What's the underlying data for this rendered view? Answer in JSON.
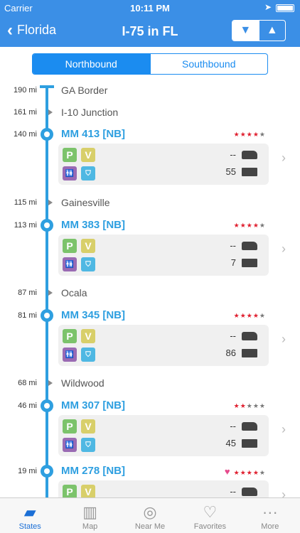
{
  "status": {
    "carrier": "Carrier",
    "time": "10:11 PM"
  },
  "nav": {
    "back_label": "Florida",
    "title": "I-75 in FL"
  },
  "segments": {
    "northbound": "Northbound",
    "southbound": "Southbound"
  },
  "route": {
    "landmarks": [
      {
        "mile": "190 mi",
        "name": "GA Border"
      },
      {
        "mile": "161 mi",
        "name": "I-10 Junction"
      },
      {
        "mile": "115 mi",
        "name": "Gainesville"
      },
      {
        "mile": "87 mi",
        "name": "Ocala"
      },
      {
        "mile": "68 mi",
        "name": "Wildwood"
      }
    ],
    "stops": [
      {
        "mile": "140 mi",
        "name": "MM 413 [NB]",
        "car_count": "--",
        "truck_count": "55",
        "rating": 4,
        "favorite": false
      },
      {
        "mile": "113 mi",
        "name": "MM 383 [NB]",
        "car_count": "--",
        "truck_count": "7",
        "rating": 4,
        "favorite": false
      },
      {
        "mile": "81 mi",
        "name": "MM 345 [NB]",
        "car_count": "--",
        "truck_count": "86",
        "rating": 4,
        "favorite": false
      },
      {
        "mile": "46 mi",
        "name": "MM 307 [NB]",
        "car_count": "--",
        "truck_count": "45",
        "rating": 2,
        "favorite": false
      },
      {
        "mile": "19 mi",
        "name": "MM 278 [NB]",
        "car_count": "--",
        "truck_count": "",
        "rating": 4,
        "favorite": true
      }
    ],
    "amenity_labels": {
      "parking": "P",
      "vending": "V"
    }
  },
  "tabs": {
    "states": "States",
    "map": "Map",
    "near_me": "Near Me",
    "favorites": "Favorites",
    "more": "More"
  }
}
